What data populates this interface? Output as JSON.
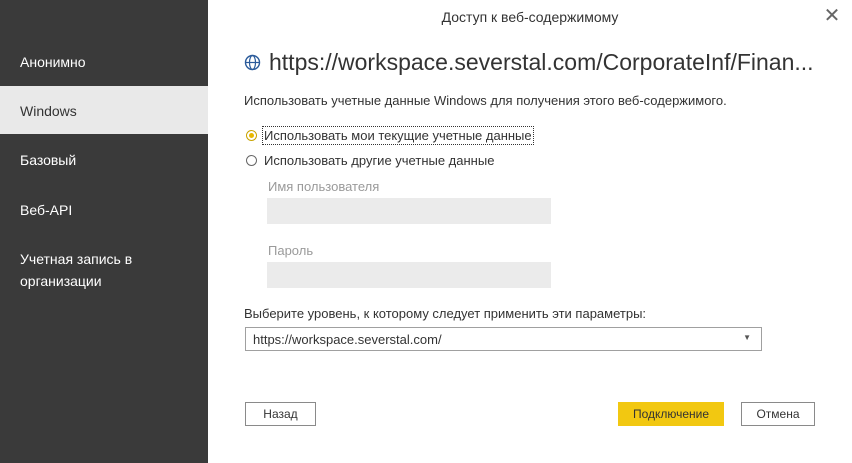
{
  "dialog": {
    "title": "Доступ к веб-содержимому",
    "close_symbol": "✕"
  },
  "sidebar": {
    "items": [
      {
        "label": "Анонимно",
        "selected": false
      },
      {
        "label": "Windows",
        "selected": true
      },
      {
        "label": "Базовый",
        "selected": false
      },
      {
        "label": "Веб-API",
        "selected": false
      },
      {
        "label": "Учетная запись в организации",
        "selected": false
      }
    ]
  },
  "main": {
    "url": "https://workspace.severstal.com/CorporateInf/Finan...",
    "url_icon": "globe-icon",
    "description": "Использовать учетные данные Windows для получения этого веб-содержимого.",
    "radio_current": "Использовать мои текущие учетные данные",
    "radio_other": "Использовать другие учетные данные",
    "selected_radio": "current",
    "username_label": "Имя пользователя",
    "username_value": "",
    "password_label": "Пароль",
    "password_value": "",
    "level_label": "Выберите уровень, к которому следует применить эти параметры:",
    "level_value": "https://workspace.severstal.com/"
  },
  "buttons": {
    "back": "Назад",
    "connect": "Подключение",
    "cancel": "Отмена"
  },
  "colors": {
    "sidebar_bg": "#3a3a3a",
    "sidebar_selected_bg": "#e9e9e9",
    "accent": "#f2c811",
    "radio_accent": "#e8b800"
  }
}
